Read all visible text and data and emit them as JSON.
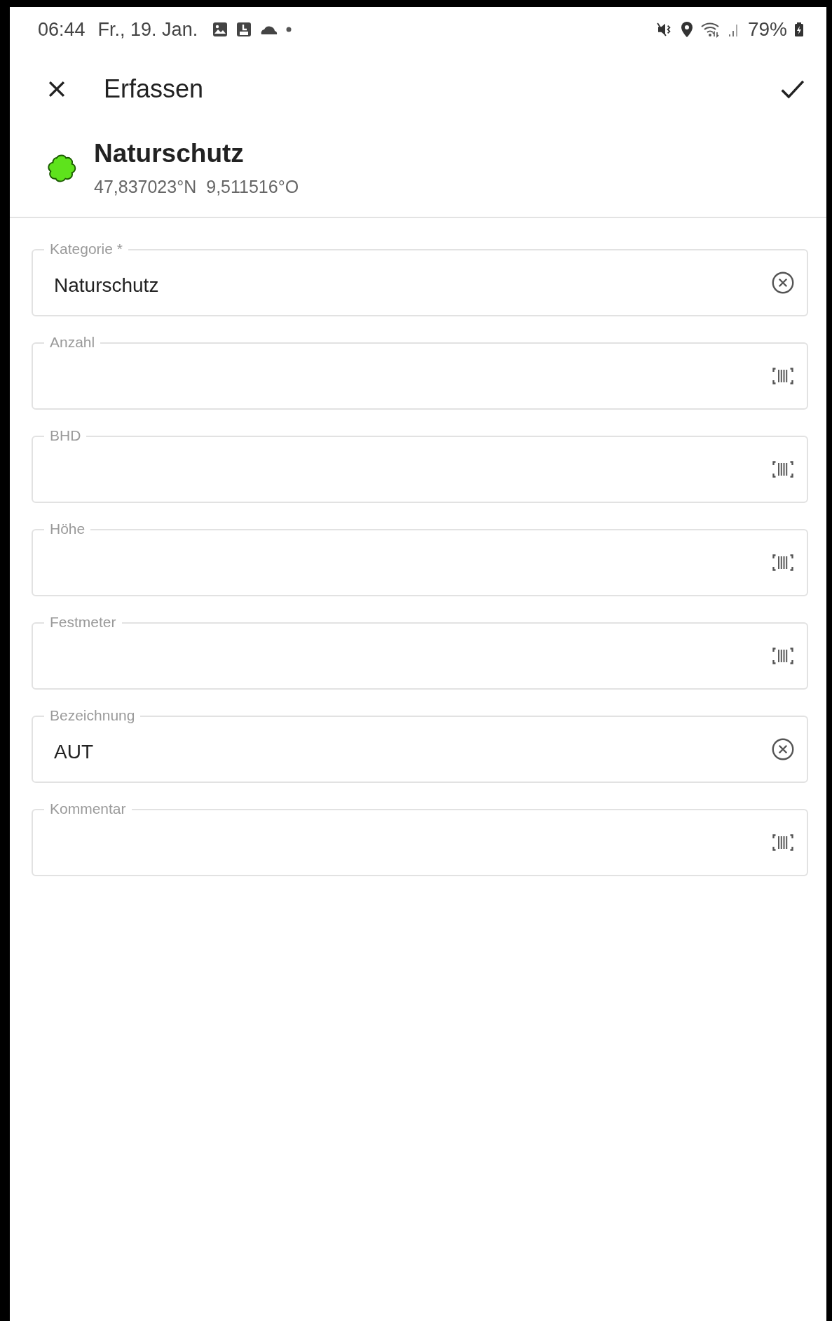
{
  "status_bar": {
    "time": "06:44",
    "date": "Fr., 19. Jan.",
    "battery": "79%"
  },
  "app_bar": {
    "title": "Erfassen"
  },
  "header": {
    "title": "Naturschutz",
    "coordinates": [
      "47,837023°N",
      "9,511516°O"
    ],
    "color": "#5ee31c"
  },
  "fields": [
    {
      "label": "Kategorie *",
      "value": "Naturschutz",
      "kind": "clear"
    },
    {
      "label": "Anzahl",
      "kind": "scan"
    },
    {
      "label": "BHD",
      "kind": "scan"
    },
    {
      "label": "Höhe",
      "kind": "scan"
    },
    {
      "label": "Festmeter",
      "kind": "scan"
    },
    {
      "label": "Bezeichnung",
      "value": "AUT",
      "kind": "clear"
    },
    {
      "label": "Kommentar",
      "kind": "scan"
    }
  ]
}
